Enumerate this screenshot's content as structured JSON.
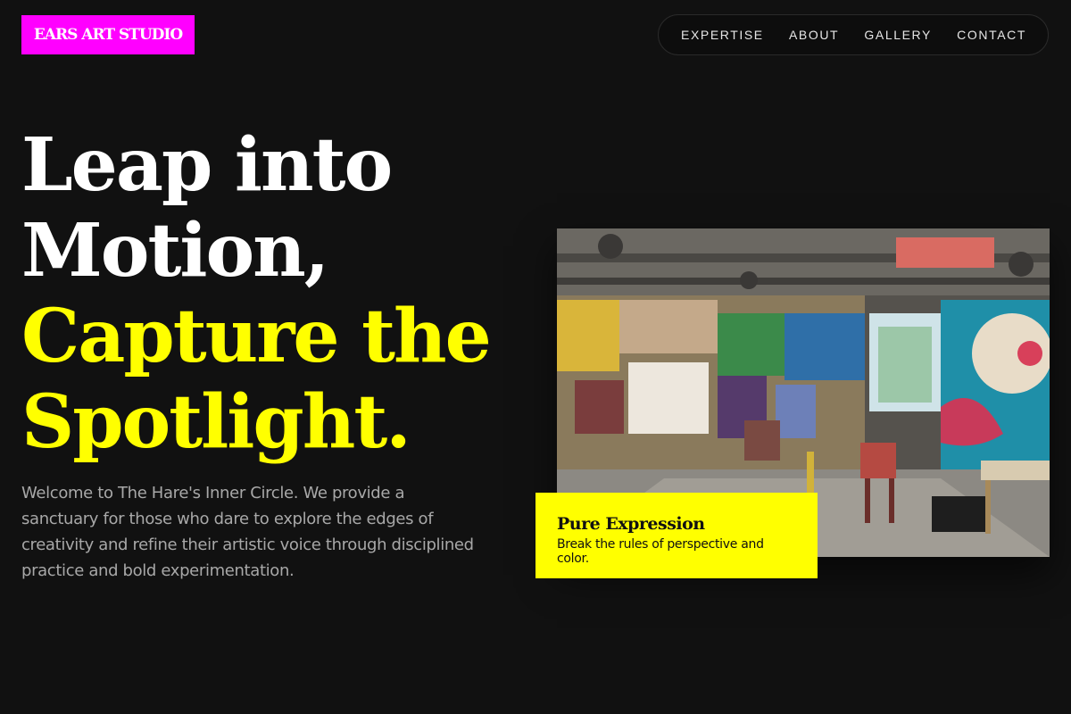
{
  "header": {
    "logo_text": "EARS ART STUDIO",
    "nav": [
      "EXPERTISE",
      "ABOUT",
      "GALLERY",
      "CONTACT"
    ]
  },
  "hero": {
    "headline_line1": "Leap into",
    "headline_line2": "Motion,",
    "headline_line3": "Capture the",
    "headline_line4": "Spotlight.",
    "intro": "Welcome to The Hare's Inner Circle. We provide a sanctuary for those who dare to explore the edges of creativity and refine their artistic voice through disciplined practice and bold experimentation."
  },
  "feature": {
    "image_desc_icon": "studio-photo",
    "caption_title": "Pure Expression",
    "caption_text": "Break the rules of perspective and color."
  },
  "colors": {
    "background": "#111111",
    "accent_yellow": "#ffff00",
    "logo_magenta": "#ff00ff",
    "intro_text": "#a8a8a8"
  }
}
